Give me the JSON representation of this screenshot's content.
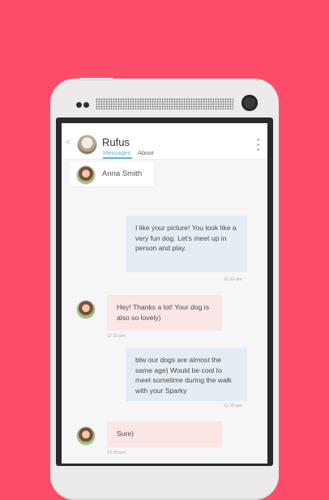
{
  "header": {
    "back_glyph": "<",
    "name": "Rufus",
    "tabs": [
      {
        "label": "Messages",
        "active": true
      },
      {
        "label": "About",
        "active": false
      }
    ]
  },
  "contact": {
    "name": "Anna Smith"
  },
  "messages": [
    {
      "direction": "outgoing",
      "text": "I like your picture! You look like a very fun dog. Let's meet up in person and play.",
      "time": "11:10 am"
    },
    {
      "direction": "incoming",
      "text": "Hey! Thanks a lot! Your dog is also so lovely)",
      "time": "12:25 pm"
    },
    {
      "direction": "outgoing",
      "text": "btw our dogs are almost the same age) Would be cool to meet sometime during the walk with your Sparky",
      "time": "12:30 pm"
    },
    {
      "direction": "incoming",
      "text": "Sure)",
      "time": "12:39 pm"
    }
  ],
  "colors": {
    "background": "#fb4d6a",
    "accent": "#69b5d8",
    "outgoing_bubble": "#e4edf3",
    "incoming_bubble": "#fbe6e6"
  }
}
